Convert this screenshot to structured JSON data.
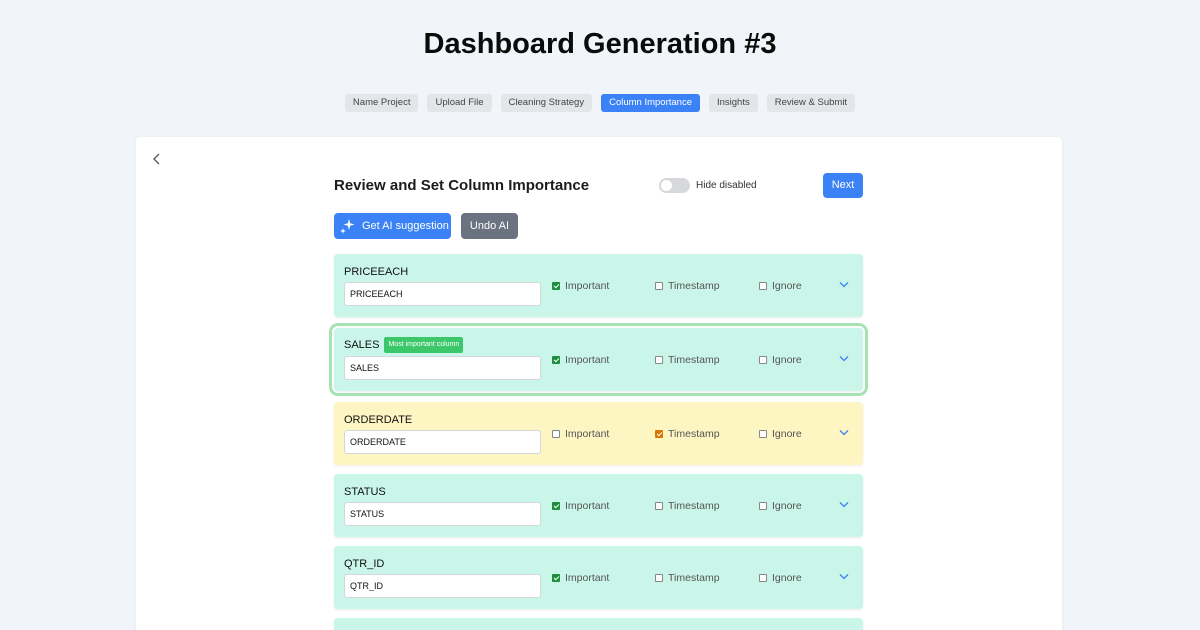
{
  "page": {
    "title": "Dashboard Generation #3"
  },
  "steps": [
    {
      "label": "Name Project",
      "active": false
    },
    {
      "label": "Upload File",
      "active": false
    },
    {
      "label": "Cleaning Strategy",
      "active": false
    },
    {
      "label": "Column Importance",
      "active": true
    },
    {
      "label": "Insights",
      "active": false
    },
    {
      "label": "Review & Submit",
      "active": false
    }
  ],
  "panel": {
    "heading": "Review and Set Column Importance",
    "toggle_label": "Hide disabled",
    "toggle_on": false,
    "next_label": "Next",
    "ai_label": "Get AI suggestion",
    "undo_label": "Undo AI"
  },
  "option_labels": {
    "important": "Important",
    "timestamp": "Timestamp",
    "ignore": "Ignore"
  },
  "columns": [
    {
      "name": "PRICEEACH",
      "value": "PRICEEACH",
      "important": true,
      "timestamp": false,
      "ignore": false,
      "badge": ""
    },
    {
      "name": "SALES",
      "value": "SALES",
      "important": true,
      "timestamp": false,
      "ignore": false,
      "badge": "Most important column"
    },
    {
      "name": "ORDERDATE",
      "value": "ORDERDATE",
      "important": false,
      "timestamp": true,
      "ignore": false,
      "badge": ""
    },
    {
      "name": "STATUS",
      "value": "STATUS",
      "important": true,
      "timestamp": false,
      "ignore": false,
      "badge": ""
    },
    {
      "name": "QTR_ID",
      "value": "QTR_ID",
      "important": true,
      "timestamp": false,
      "ignore": false,
      "badge": ""
    }
  ],
  "colors": {
    "accent": "#3b82f6",
    "row_default": "#c9f6e9",
    "row_timestamp": "#fdf5c2",
    "highlight": "#a7e2b4",
    "badge": "#3cc86a",
    "undo": "#6b7280"
  },
  "icons": {
    "back": "chevron-left-icon",
    "ai": "sparkle-icon",
    "expand": "chevron-down-icon"
  }
}
